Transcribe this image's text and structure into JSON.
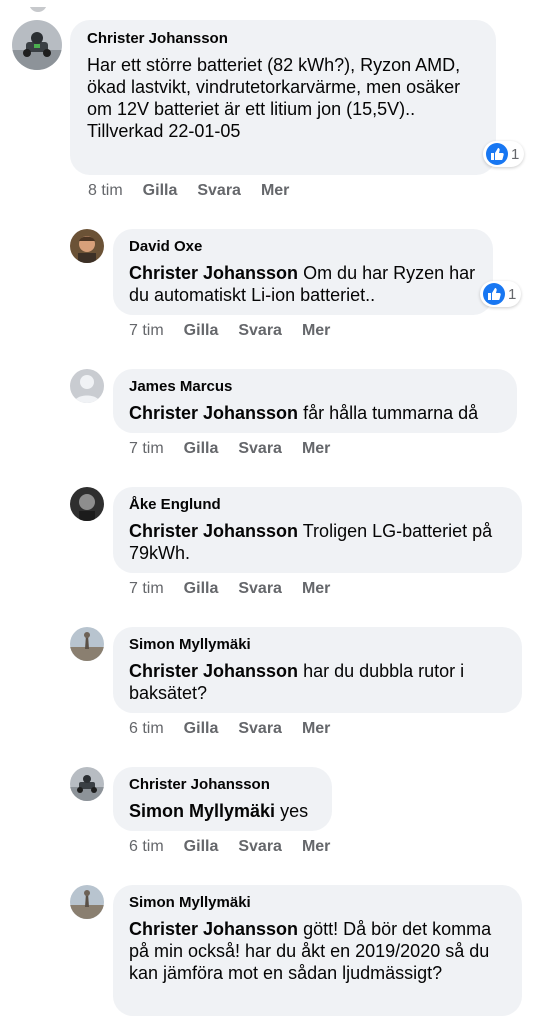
{
  "colors": {
    "bubble": "#f0f2f5",
    "like_blue": "#1877f2",
    "meta_grey": "#65676b"
  },
  "comments": [
    {
      "author": "Christer Johansson",
      "mention": "",
      "text": "Har ett större batteriet (82 kWh?), Ryzon AMD, ökad lastvikt, vindrutetorkarvärme, men osäker om 12V batteriet är ett litium jon (15,5V)..",
      "text2": "Tillverkad 22-01-05",
      "time": "8 tim",
      "like": "Gilla",
      "reply": "Svara",
      "more": "Mer",
      "reaction_count": "1",
      "reaction_icon": "like-icon"
    },
    {
      "author": "David Oxe",
      "mention": "Christer Johansson",
      "text": "Om du har Ryzen har du automatiskt Li-ion batteriet..",
      "time": "7 tim",
      "like": "Gilla",
      "reply": "Svara",
      "more": "Mer",
      "reaction_count": "1",
      "reaction_icon": "like-icon"
    },
    {
      "author": "James Marcus",
      "mention": "Christer Johansson",
      "text": "får hålla tummarna då",
      "time": "7 tim",
      "like": "Gilla",
      "reply": "Svara",
      "more": "Mer"
    },
    {
      "author": "Åke Englund",
      "mention": "Christer Johansson",
      "text": "Troligen LG-batteriet på 79kWh.",
      "time": "7 tim",
      "like": "Gilla",
      "reply": "Svara",
      "more": "Mer"
    },
    {
      "author": "Simon Myllymäki",
      "mention": "Christer Johansson",
      "text": "har du dubbla rutor i baksätet?",
      "time": "6 tim",
      "like": "Gilla",
      "reply": "Svara",
      "more": "Mer"
    },
    {
      "author": "Christer Johansson",
      "mention": "Simon Myllymäki",
      "text": "yes",
      "time": "6 tim",
      "like": "Gilla",
      "reply": "Svara",
      "more": "Mer"
    },
    {
      "author": "Simon Myllymäki",
      "mention": "Christer Johansson",
      "text": "gött! Då bör det komma på min också! har du åkt en 2019/2020 så du kan jämföra mot en sådan ljudmässigt?"
    }
  ]
}
